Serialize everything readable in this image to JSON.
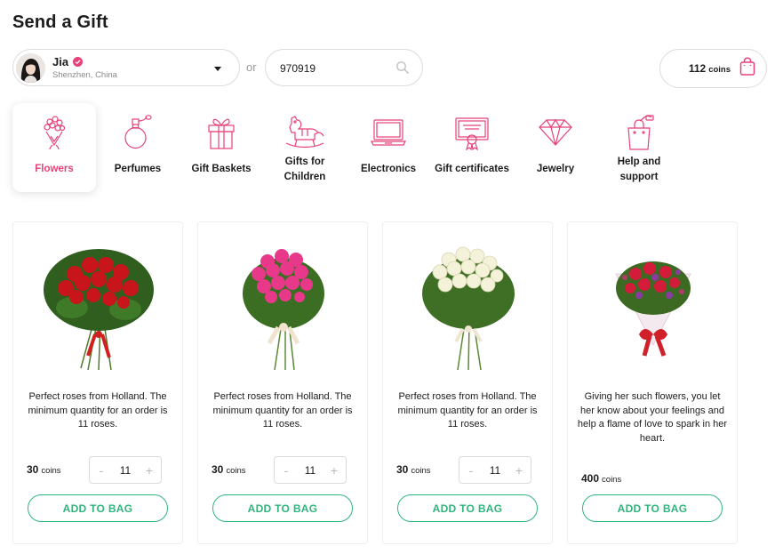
{
  "page": {
    "title": "Send a Gift"
  },
  "recipient": {
    "name": "Jia",
    "location": "Shenzhen, China"
  },
  "or_label": "or",
  "search": {
    "value": "970919"
  },
  "wallet": {
    "amount": "112",
    "unit": "coins"
  },
  "categories": [
    {
      "label": "Flowers",
      "icon": "bouquet-icon",
      "active": true
    },
    {
      "label": "Perfumes",
      "icon": "perfume-bottle-icon"
    },
    {
      "label": "Gift Baskets",
      "icon": "gift-box-icon"
    },
    {
      "label": "Gifts for Children",
      "icon": "rocking-horse-icon"
    },
    {
      "label": "Electronics",
      "icon": "laptop-icon"
    },
    {
      "label": "Gift certificates",
      "icon": "certificate-icon"
    },
    {
      "label": "Jewelry",
      "icon": "diamond-icon"
    },
    {
      "label": "Help and support",
      "icon": "gift-bag-help-icon"
    }
  ],
  "products": [
    {
      "image": "red-roses-bouquet",
      "description": "Perfect roses from Holland. The minimum quantity for an order is 11 roses.",
      "price": "30",
      "price_unit": "coins",
      "quantity": "11",
      "minus": "-",
      "plus": "+",
      "button": "ADD TO BAG"
    },
    {
      "image": "pink-roses-bouquet",
      "description": "Perfect roses from Holland. The minimum quantity for an order is 11 roses.",
      "price": "30",
      "price_unit": "coins",
      "quantity": "11",
      "minus": "-",
      "plus": "+",
      "button": "ADD TO BAG"
    },
    {
      "image": "white-roses-bouquet",
      "description": "Perfect roses from Holland. The minimum quantity for an order is 11 roses.",
      "price": "30",
      "price_unit": "coins",
      "quantity": "11",
      "minus": "-",
      "plus": "+",
      "button": "ADD TO BAG"
    },
    {
      "image": "mixed-flowers-bouquet",
      "description": "Giving her such flowers, you let her know about your feelings and help a flame of love to spark in her heart.",
      "price": "400",
      "price_unit": "coins",
      "button": "ADD TO BAG"
    }
  ],
  "colors": {
    "accent": "#e6417a",
    "primary_green": "#2eb67d",
    "border": "#dcdcdc"
  }
}
